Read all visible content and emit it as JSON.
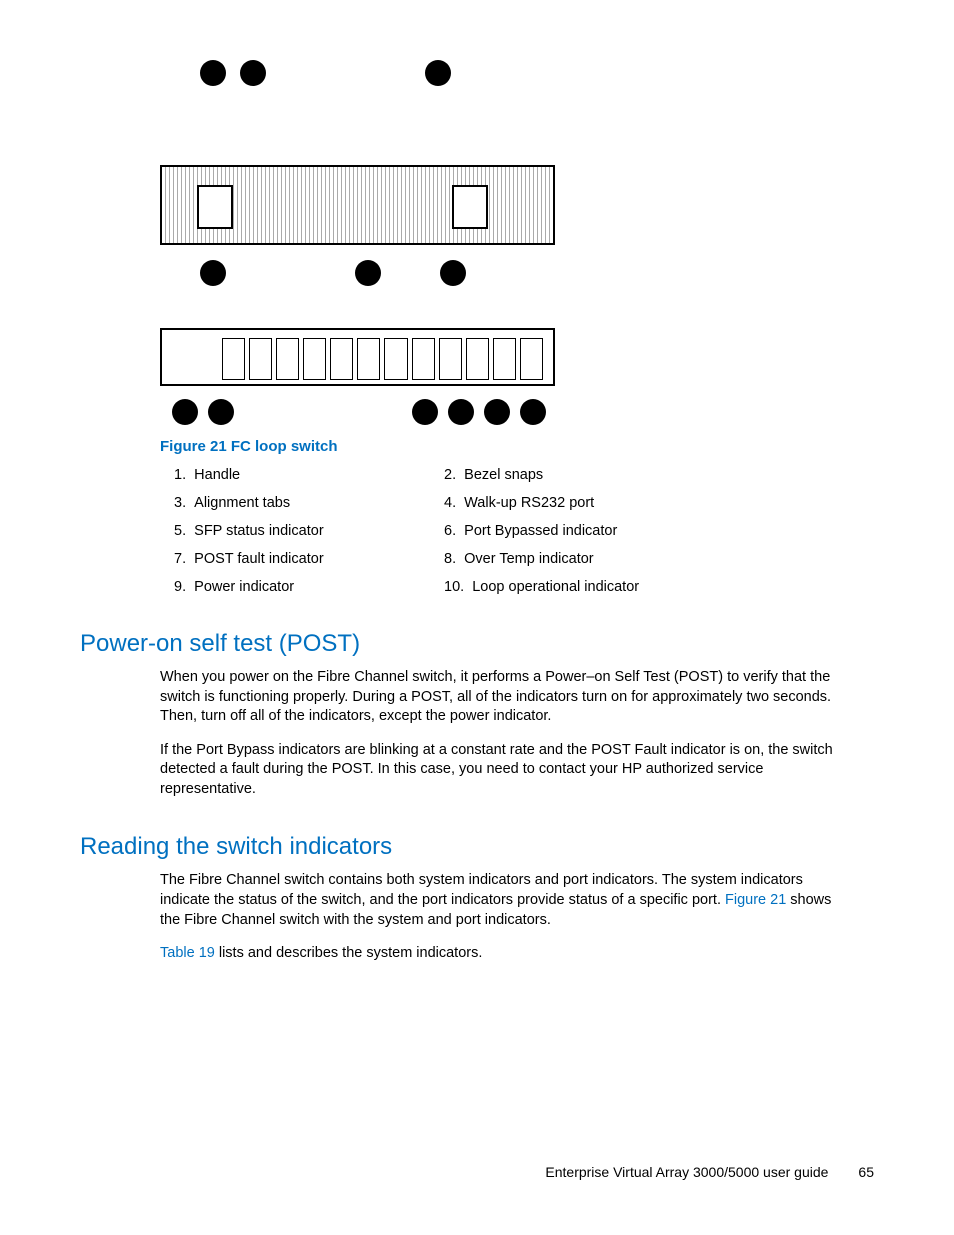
{
  "figure": {
    "caption": "Figure 21 FC loop switch",
    "legend": [
      {
        "n": "1.",
        "t": "Handle"
      },
      {
        "n": "2.",
        "t": "Bezel snaps"
      },
      {
        "n": "3.",
        "t": "Alignment tabs"
      },
      {
        "n": "4.",
        "t": "Walk-up RS232 port"
      },
      {
        "n": "5.",
        "t": "SFP status indicator"
      },
      {
        "n": "6.",
        "t": "Port Bypassed indicator"
      },
      {
        "n": "7.",
        "t": "POST fault indicator"
      },
      {
        "n": "8.",
        "t": "Over Temp indicator"
      },
      {
        "n": "9.",
        "t": "Power indicator"
      },
      {
        "n": "10.",
        "t": "Loop operational indicator"
      }
    ]
  },
  "sections": {
    "post": {
      "heading": "Power-on self test (POST)",
      "p1": "When you power on the Fibre Channel switch, it performs a Power–on Self Test (POST) to verify that the switch is functioning properly. During a POST, all of the indicators turn on for approximately two seconds. Then, turn off all of the indicators, except the power indicator.",
      "p2": "If the Port Bypass indicators are blinking at a constant rate and the POST Fault indicator is on, the switch detected a fault during the POST. In this case, you need to contact your HP authorized service representative."
    },
    "indicators": {
      "heading": "Reading the switch indicators",
      "p1a": "The Fibre Channel switch contains both system indicators and port indicators. The system indicators indicate the status of the switch, and the port indicators provide status of a specific port. ",
      "p1_link": "Figure 21",
      "p1b": " shows the Fibre Channel switch with the system and port indicators.",
      "p2_link": "Table 19",
      "p2": " lists and describes the system indicators."
    }
  },
  "footer": {
    "doc": "Enterprise Virtual Array 3000/5000 user guide",
    "page": "65"
  }
}
